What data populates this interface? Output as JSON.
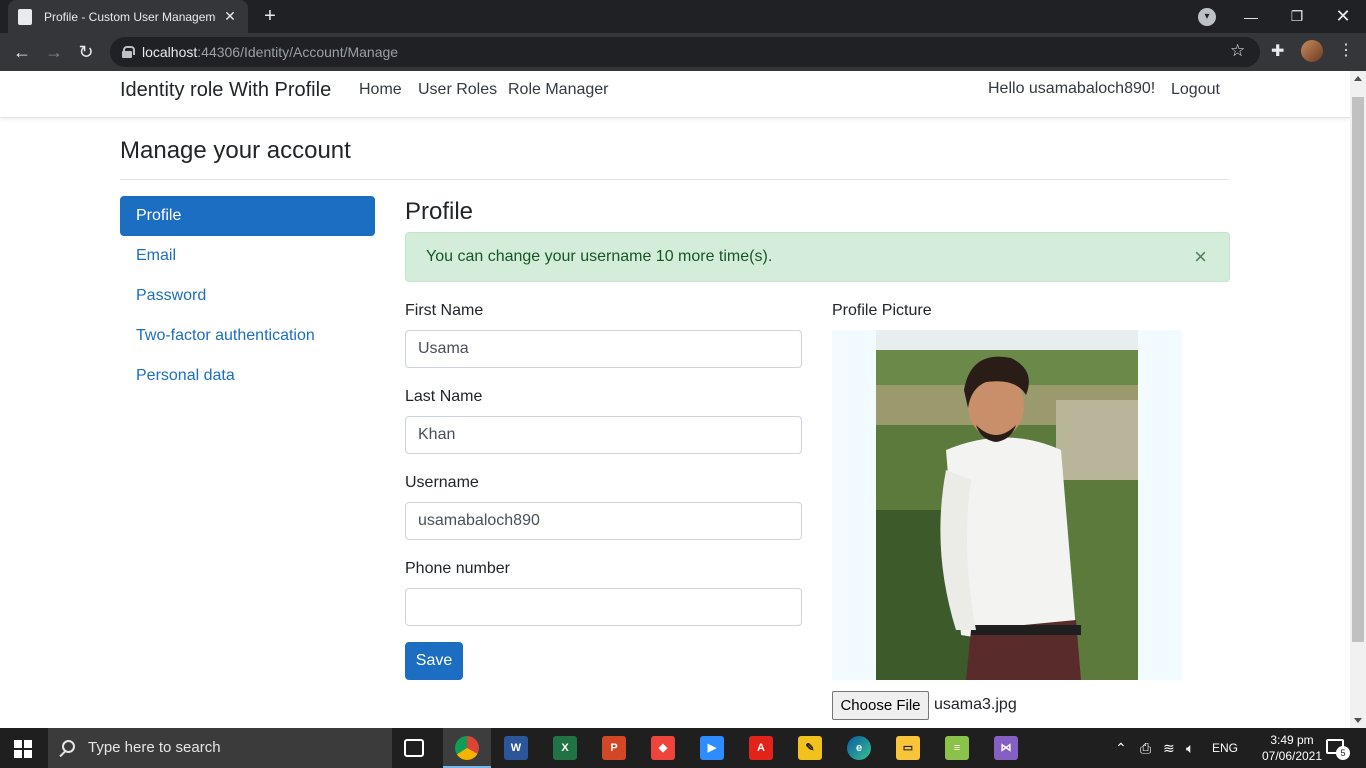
{
  "browser": {
    "tab_title": "Profile - Custom User Manageme",
    "url_host": "localhost",
    "url_path": ":44306/Identity/Account/Manage"
  },
  "site": {
    "brand": "Identity role With Profile",
    "nav": [
      "Home",
      "User Roles",
      "Role Manager"
    ],
    "greeting": "Hello usamabaloch890!",
    "logout": "Logout"
  },
  "manage": {
    "heading": "Manage your account",
    "sidenav": [
      "Profile",
      "Email",
      "Password",
      "Two-factor authentication",
      "Personal data"
    ],
    "active_index": 0
  },
  "profile": {
    "heading": "Profile",
    "alert": "You can change your username 10 more time(s).",
    "alert_close": "×",
    "first_name_label": "First Name",
    "first_name": "Usama",
    "last_name_label": "Last Name",
    "last_name": "Khan",
    "username_label": "Username",
    "username": "usamabaloch890",
    "phone_label": "Phone number",
    "phone": "",
    "save": "Save",
    "picture_label": "Profile Picture",
    "choose_file": "Choose File",
    "file_name": "usama3.jpg"
  },
  "taskbar": {
    "search_placeholder": "Type here to search",
    "language": "ENG",
    "time": "3:49 pm",
    "date": "07/06/2021",
    "notifications": "5",
    "apps": [
      "task-view-icon",
      "chrome-icon",
      "word-icon",
      "excel-icon",
      "powerpoint-icon",
      "anydesk-icon",
      "zoom-icon",
      "acrobat-icon",
      "whiteboard-icon",
      "edge-icon",
      "file-explorer-icon",
      "notepad-icon",
      "visual-studio-icon"
    ]
  },
  "colors": {
    "primary": "#1b6ec2",
    "alert_bg": "#d4edda",
    "alert_text": "#155724"
  }
}
